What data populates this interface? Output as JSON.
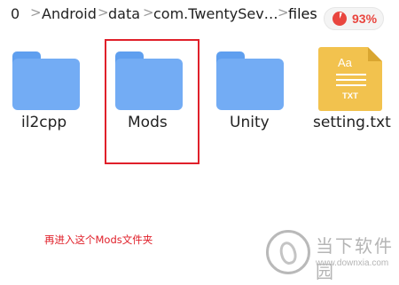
{
  "breadcrumb": {
    "items": [
      "0",
      "Android",
      "data",
      "com.TwentySev…",
      "files"
    ],
    "separator": ">"
  },
  "storage": {
    "percent_label": "93%",
    "used_fraction": 0.93,
    "accent": "#e9463f"
  },
  "files": [
    {
      "name": "il2cpp",
      "type": "folder"
    },
    {
      "name": "Mods",
      "type": "folder"
    },
    {
      "name": "Unity",
      "type": "folder"
    },
    {
      "name": "setting.txt",
      "type": "txt",
      "icon_text_top": "Aa",
      "icon_text_bottom": "TXT"
    }
  ],
  "annotation": {
    "instruction": "再进入这个Mods文件夹",
    "highlight_color": "#e0202a",
    "highlighted_item": "Mods"
  },
  "watermark": {
    "title": "当下软件园",
    "url": "www.downxia.com"
  },
  "colors": {
    "folder": "#73acf4",
    "folder_tab": "#5f9fef",
    "txt_icon": "#f2c24e"
  }
}
